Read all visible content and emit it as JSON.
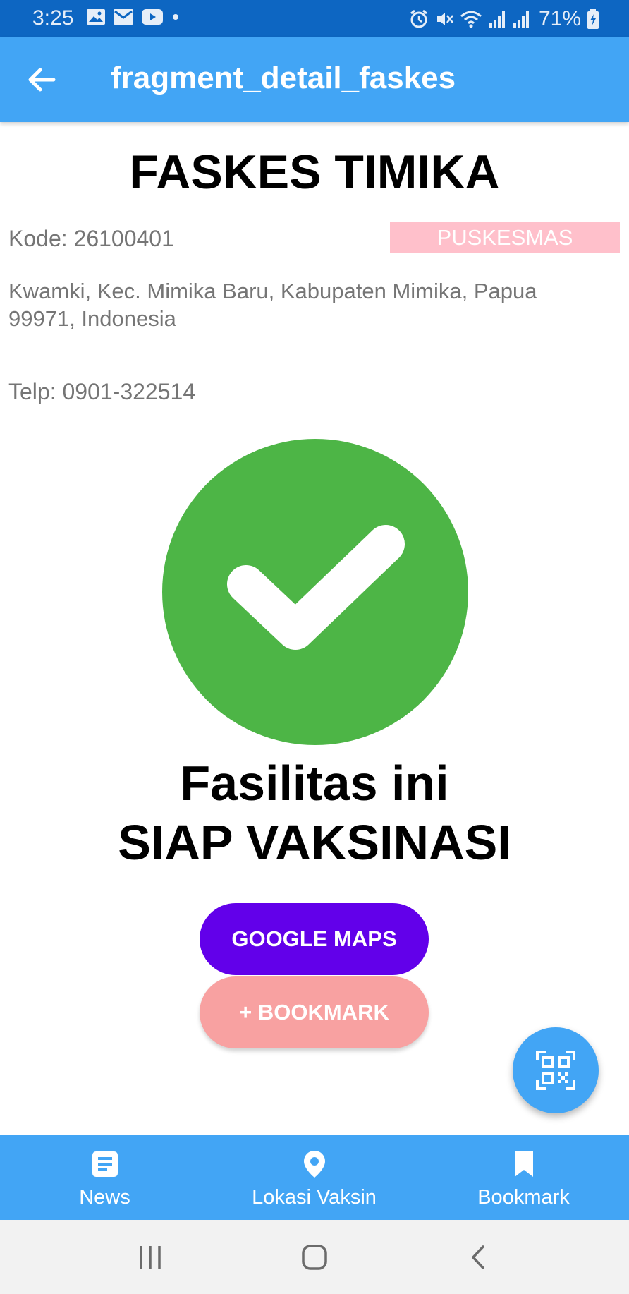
{
  "status_bar": {
    "time": "3:25",
    "battery": "71%",
    "left_icons": [
      "image-icon",
      "mail-icon",
      "youtube-icon",
      "dot-icon"
    ],
    "right_icons": [
      "alarm-icon",
      "mute-icon",
      "wifi-icon",
      "signal-icon",
      "signal-icon",
      "battery-icon"
    ]
  },
  "app_bar": {
    "title": "fragment_detail_faskes",
    "back_icon": "arrow-back-icon"
  },
  "faskes": {
    "name": "FASKES TIMIKA",
    "kode": "Kode: 26100401",
    "type": "PUSKESMAS",
    "address": "Kwamki, Kec. Mimika Baru, Kabupaten Mimika, Papua 99971, Indonesia",
    "telp": "Telp: 0901-322514"
  },
  "status": {
    "line1": "Fasilitas ini",
    "line2": "SIAP VAKSINASI",
    "icon": "check-circle-icon"
  },
  "buttons": {
    "maps": "GOOGLE MAPS",
    "bookmark": "+ BOOKMARK"
  },
  "fab": {
    "icon": "qr-code-icon"
  },
  "bottom_nav": {
    "items": [
      {
        "label": "News",
        "icon": "article-icon"
      },
      {
        "label": "Lokasi Vaksin",
        "icon": "location-pin-icon"
      },
      {
        "label": "Bookmark",
        "icon": "bookmark-icon"
      }
    ]
  },
  "system_nav": [
    "recents-icon",
    "home-icon",
    "back-icon"
  ],
  "colors": {
    "status_bar": "#0d66c2",
    "primary": "#42a5f5",
    "success": "#4db546",
    "maps_button": "#6200ea",
    "bookmark_button": "#f8a1a1",
    "badge": "#ffc0cb"
  }
}
